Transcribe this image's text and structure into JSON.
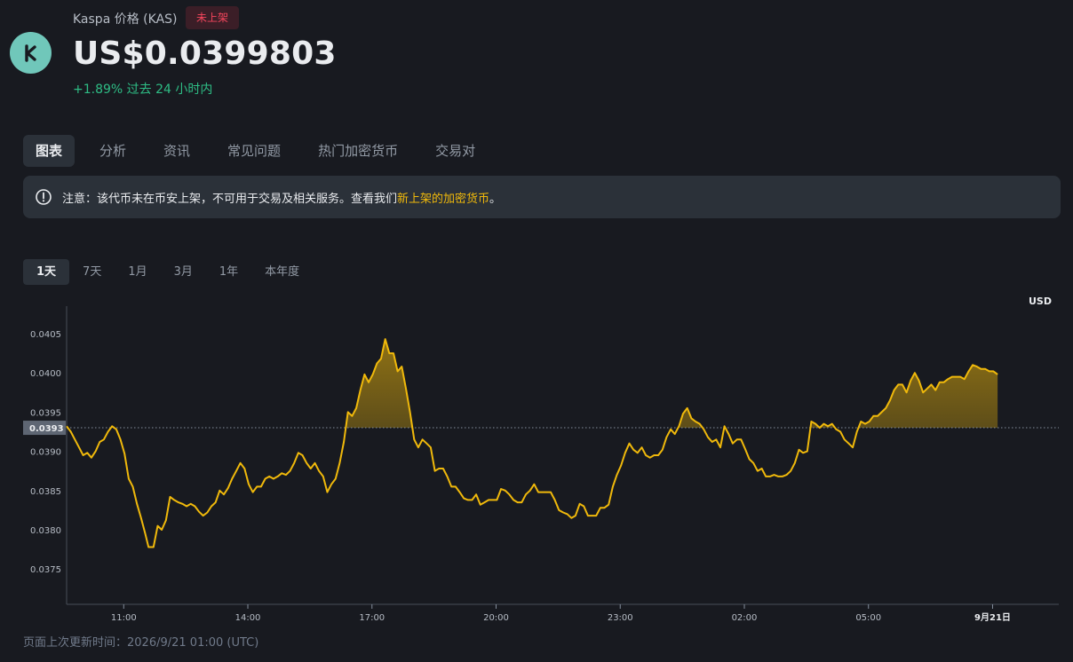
{
  "header": {
    "coin_name": "Kaspa 价格 (KAS)",
    "badge": "未上架",
    "price": "US$0.0399803",
    "change": "+1.89% 过去 24 小时内"
  },
  "tabs": [
    "图表",
    "分析",
    "资讯",
    "常见问题",
    "热门加密货币",
    "交易对"
  ],
  "notice": {
    "text": "注意：该代币未在币安上架，不可用于交易及相关服务。查看我们",
    "link": "新上架的加密货币",
    "suffix": "。"
  },
  "ranges": [
    "1天",
    "7天",
    "1月",
    "3月",
    "1年",
    "本年度"
  ],
  "footer": {
    "label": "页面上次更新时间：",
    "value": "2026/9/21 01:00 (UTC)"
  },
  "colors": {
    "line": "#f0b90b",
    "positive": "#2ebd85",
    "negative": "#f6465d",
    "accent": "#f0b90b"
  },
  "chart_data": {
    "type": "area",
    "currency_label": "USD",
    "baseline": 0.0393,
    "baseline_label": "0.0393",
    "ylim": [
      0.03705,
      0.04085
    ],
    "yticks": [
      0.0375,
      0.038,
      0.0385,
      0.039,
      0.0395,
      0.04,
      0.0405
    ],
    "ytick_labels": [
      "0.0375",
      "0.0380",
      "0.0385",
      "0.0390",
      "0.0395",
      "0.0400",
      "0.0405"
    ],
    "xlim": [
      9.62,
      33.6
    ],
    "xticks": [
      11,
      14,
      17,
      20,
      23,
      26,
      29,
      32
    ],
    "xtick_labels": [
      "11:00",
      "14:00",
      "17:00",
      "20:00",
      "23:00",
      "02:00",
      "05:00",
      "9月21日"
    ],
    "x_unit": "hours",
    "points": [
      [
        9.62,
        0.03932
      ],
      [
        9.72,
        0.03925
      ],
      [
        9.82,
        0.03915
      ],
      [
        9.92,
        0.03905
      ],
      [
        10.02,
        0.03895
      ],
      [
        10.12,
        0.03898
      ],
      [
        10.22,
        0.03892
      ],
      [
        10.32,
        0.039
      ],
      [
        10.42,
        0.03912
      ],
      [
        10.52,
        0.03915
      ],
      [
        10.62,
        0.03925
      ],
      [
        10.72,
        0.03932
      ],
      [
        10.82,
        0.03928
      ],
      [
        10.92,
        0.03915
      ],
      [
        11.02,
        0.03897
      ],
      [
        11.12,
        0.03865
      ],
      [
        11.22,
        0.03855
      ],
      [
        11.32,
        0.03833
      ],
      [
        11.42,
        0.03815
      ],
      [
        11.52,
        0.03795
      ],
      [
        11.6,
        0.03778
      ],
      [
        11.72,
        0.03778
      ],
      [
        11.82,
        0.03805
      ],
      [
        11.92,
        0.038
      ],
      [
        12.02,
        0.03812
      ],
      [
        12.12,
        0.03842
      ],
      [
        12.22,
        0.03838
      ],
      [
        12.32,
        0.03835
      ],
      [
        12.42,
        0.03833
      ],
      [
        12.52,
        0.0383
      ],
      [
        12.62,
        0.03833
      ],
      [
        12.72,
        0.0383
      ],
      [
        12.82,
        0.03823
      ],
      [
        12.92,
        0.03818
      ],
      [
        13.02,
        0.03822
      ],
      [
        13.12,
        0.0383
      ],
      [
        13.22,
        0.03835
      ],
      [
        13.32,
        0.0385
      ],
      [
        13.42,
        0.03845
      ],
      [
        13.52,
        0.03853
      ],
      [
        13.62,
        0.03865
      ],
      [
        13.72,
        0.03875
      ],
      [
        13.82,
        0.03885
      ],
      [
        13.92,
        0.03878
      ],
      [
        14.02,
        0.03858
      ],
      [
        14.12,
        0.03848
      ],
      [
        14.22,
        0.03855
      ],
      [
        14.32,
        0.03855
      ],
      [
        14.42,
        0.03865
      ],
      [
        14.52,
        0.03868
      ],
      [
        14.62,
        0.03865
      ],
      [
        14.72,
        0.03868
      ],
      [
        14.82,
        0.03872
      ],
      [
        14.92,
        0.0387
      ],
      [
        15.02,
        0.03875
      ],
      [
        15.12,
        0.03885
      ],
      [
        15.22,
        0.03898
      ],
      [
        15.32,
        0.03895
      ],
      [
        15.42,
        0.03885
      ],
      [
        15.52,
        0.03878
      ],
      [
        15.62,
        0.03885
      ],
      [
        15.72,
        0.03875
      ],
      [
        15.82,
        0.03868
      ],
      [
        15.92,
        0.03848
      ],
      [
        16.02,
        0.03858
      ],
      [
        16.12,
        0.03865
      ],
      [
        16.22,
        0.03885
      ],
      [
        16.32,
        0.03912
      ],
      [
        16.42,
        0.0395
      ],
      [
        16.52,
        0.03945
      ],
      [
        16.62,
        0.03955
      ],
      [
        16.72,
        0.03978
      ],
      [
        16.82,
        0.03998
      ],
      [
        16.92,
        0.03988
      ],
      [
        17.02,
        0.03998
      ],
      [
        17.12,
        0.04012
      ],
      [
        17.22,
        0.04018
      ],
      [
        17.32,
        0.04043
      ],
      [
        17.42,
        0.04025
      ],
      [
        17.52,
        0.04025
      ],
      [
        17.62,
        0.04002
      ],
      [
        17.72,
        0.04008
      ],
      [
        17.82,
        0.0398
      ],
      [
        17.92,
        0.0395
      ],
      [
        18.02,
        0.03915
      ],
      [
        18.12,
        0.03905
      ],
      [
        18.22,
        0.03915
      ],
      [
        18.32,
        0.0391
      ],
      [
        18.42,
        0.03905
      ],
      [
        18.52,
        0.03875
      ],
      [
        18.62,
        0.03878
      ],
      [
        18.72,
        0.03878
      ],
      [
        18.82,
        0.03868
      ],
      [
        18.92,
        0.03855
      ],
      [
        19.02,
        0.03855
      ],
      [
        19.12,
        0.03848
      ],
      [
        19.22,
        0.0384
      ],
      [
        19.32,
        0.03838
      ],
      [
        19.42,
        0.03838
      ],
      [
        19.52,
        0.03845
      ],
      [
        19.62,
        0.03832
      ],
      [
        19.72,
        0.03835
      ],
      [
        19.82,
        0.03838
      ],
      [
        19.92,
        0.03838
      ],
      [
        20.02,
        0.03838
      ],
      [
        20.12,
        0.03852
      ],
      [
        20.22,
        0.0385
      ],
      [
        20.32,
        0.03845
      ],
      [
        20.42,
        0.03838
      ],
      [
        20.52,
        0.03835
      ],
      [
        20.62,
        0.03835
      ],
      [
        20.72,
        0.03845
      ],
      [
        20.82,
        0.0385
      ],
      [
        20.92,
        0.03858
      ],
      [
        21.02,
        0.03848
      ],
      [
        21.12,
        0.03848
      ],
      [
        21.22,
        0.03848
      ],
      [
        21.32,
        0.03848
      ],
      [
        21.42,
        0.03838
      ],
      [
        21.52,
        0.03825
      ],
      [
        21.62,
        0.03822
      ],
      [
        21.72,
        0.0382
      ],
      [
        21.82,
        0.03815
      ],
      [
        21.92,
        0.03818
      ],
      [
        22.02,
        0.03833
      ],
      [
        22.12,
        0.0383
      ],
      [
        22.22,
        0.03818
      ],
      [
        22.32,
        0.03818
      ],
      [
        22.42,
        0.03818
      ],
      [
        22.52,
        0.03828
      ],
      [
        22.62,
        0.03828
      ],
      [
        22.72,
        0.03832
      ],
      [
        22.82,
        0.03855
      ],
      [
        22.92,
        0.0387
      ],
      [
        23.02,
        0.03882
      ],
      [
        23.12,
        0.03898
      ],
      [
        23.22,
        0.0391
      ],
      [
        23.32,
        0.03902
      ],
      [
        23.42,
        0.03898
      ],
      [
        23.52,
        0.03905
      ],
      [
        23.62,
        0.03895
      ],
      [
        23.72,
        0.03892
      ],
      [
        23.82,
        0.03895
      ],
      [
        23.92,
        0.03895
      ],
      [
        24.02,
        0.03902
      ],
      [
        24.12,
        0.03918
      ],
      [
        24.22,
        0.03928
      ],
      [
        24.32,
        0.03922
      ],
      [
        24.42,
        0.03932
      ],
      [
        24.52,
        0.03948
      ],
      [
        24.62,
        0.03955
      ],
      [
        24.72,
        0.03942
      ],
      [
        24.82,
        0.03938
      ],
      [
        24.92,
        0.03935
      ],
      [
        25.02,
        0.03928
      ],
      [
        25.12,
        0.03918
      ],
      [
        25.22,
        0.03912
      ],
      [
        25.32,
        0.03915
      ],
      [
        25.42,
        0.03905
      ],
      [
        25.52,
        0.03932
      ],
      [
        25.62,
        0.03922
      ],
      [
        25.72,
        0.0391
      ],
      [
        25.82,
        0.03915
      ],
      [
        25.92,
        0.03915
      ],
      [
        26.02,
        0.03903
      ],
      [
        26.12,
        0.0389
      ],
      [
        26.22,
        0.03885
      ],
      [
        26.32,
        0.03875
      ],
      [
        26.42,
        0.03878
      ],
      [
        26.52,
        0.03868
      ],
      [
        26.62,
        0.03868
      ],
      [
        26.72,
        0.0387
      ],
      [
        26.82,
        0.03868
      ],
      [
        26.92,
        0.03868
      ],
      [
        27.02,
        0.0387
      ],
      [
        27.12,
        0.03875
      ],
      [
        27.22,
        0.03885
      ],
      [
        27.32,
        0.03902
      ],
      [
        27.42,
        0.03898
      ],
      [
        27.52,
        0.039
      ],
      [
        27.62,
        0.03938
      ],
      [
        27.72,
        0.03935
      ],
      [
        27.82,
        0.0393
      ],
      [
        27.92,
        0.03935
      ],
      [
        28.02,
        0.03932
      ],
      [
        28.12,
        0.03935
      ],
      [
        28.22,
        0.03928
      ],
      [
        28.32,
        0.03925
      ],
      [
        28.42,
        0.03915
      ],
      [
        28.52,
        0.0391
      ],
      [
        28.62,
        0.03905
      ],
      [
        28.72,
        0.03925
      ],
      [
        28.82,
        0.03938
      ],
      [
        28.92,
        0.03935
      ],
      [
        29.02,
        0.03938
      ],
      [
        29.12,
        0.03945
      ],
      [
        29.22,
        0.03945
      ],
      [
        29.32,
        0.0395
      ],
      [
        29.42,
        0.03955
      ],
      [
        29.52,
        0.03965
      ],
      [
        29.62,
        0.03978
      ],
      [
        29.72,
        0.03985
      ],
      [
        29.82,
        0.03985
      ],
      [
        29.92,
        0.03975
      ],
      [
        30.02,
        0.0399
      ],
      [
        30.12,
        0.04
      ],
      [
        30.22,
        0.0399
      ],
      [
        30.32,
        0.03975
      ],
      [
        30.42,
        0.0398
      ],
      [
        30.52,
        0.03985
      ],
      [
        30.62,
        0.03978
      ],
      [
        30.72,
        0.03988
      ],
      [
        30.82,
        0.03988
      ],
      [
        30.92,
        0.03992
      ],
      [
        31.02,
        0.03995
      ],
      [
        31.12,
        0.03995
      ],
      [
        31.22,
        0.03995
      ],
      [
        31.32,
        0.03992
      ],
      [
        31.42,
        0.04002
      ],
      [
        31.52,
        0.0401
      ],
      [
        31.62,
        0.04008
      ],
      [
        31.72,
        0.04005
      ],
      [
        31.82,
        0.04005
      ],
      [
        31.92,
        0.04002
      ],
      [
        32.02,
        0.04002
      ],
      [
        32.12,
        0.03998
      ]
    ]
  }
}
